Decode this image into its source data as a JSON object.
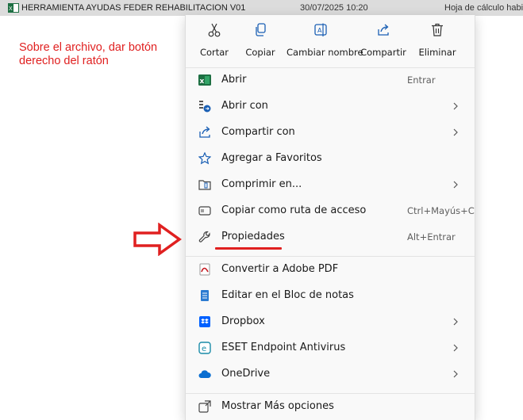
{
  "file_row": {
    "name": "HERRAMIENTA AYUDAS FEDER REHABILITACION V01",
    "date": "30/07/2025 10:20",
    "type": "Hoja de cálculo habilitada"
  },
  "note": "Sobre el archivo, dar botón derecho del ratón",
  "toolbar": {
    "cut": "Cortar",
    "copy": "Copiar",
    "rename": "Cambiar nombre",
    "share": "Compartir",
    "delete": "Eliminar"
  },
  "menu": {
    "items": [
      {
        "label": "Abrir",
        "shortcut": "Entrar"
      },
      {
        "label": "Abrir con",
        "shortcut": ""
      },
      {
        "label": "Compartir con",
        "shortcut": ""
      },
      {
        "label": "Agregar a Favoritos",
        "shortcut": ""
      },
      {
        "label": "Comprimir en...",
        "shortcut": ""
      },
      {
        "label": "Copiar como ruta de acceso",
        "shortcut": "Ctrl+Mayús+C"
      },
      {
        "label": "Propiedades",
        "shortcut": "Alt+Entrar"
      },
      {
        "label": "Convertir a Adobe PDF",
        "shortcut": ""
      },
      {
        "label": "Editar en el Bloc de notas",
        "shortcut": ""
      },
      {
        "label": "Dropbox",
        "shortcut": ""
      },
      {
        "label": "ESET Endpoint Antivirus",
        "shortcut": ""
      },
      {
        "label": "OneDrive",
        "shortcut": ""
      },
      {
        "label": "Mostrar Más opciones",
        "shortcut": ""
      }
    ]
  },
  "colors": {
    "annotation": "#e02020",
    "menu_bg": "#f9f9f9",
    "icon_blue": "#1a5fb4"
  }
}
